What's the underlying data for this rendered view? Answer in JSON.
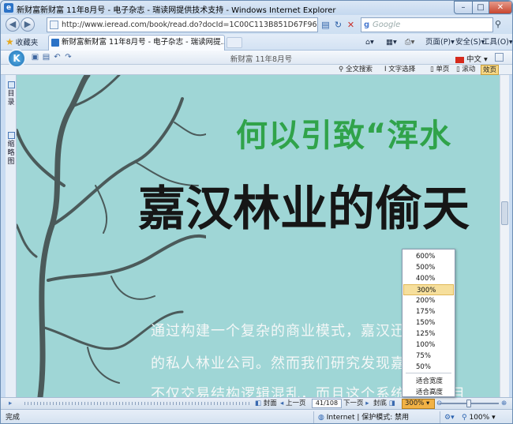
{
  "window": {
    "title": "新财富新财富 11年8月号 - 电子杂志 - 瑞读网提供技术支持 - Windows Internet Explorer",
    "min_label": "–",
    "max_label": "□",
    "close_label": "✕"
  },
  "address": {
    "url": "http://www.ieread.com/book/read.do?docId=1C00C113B851D67F965CF0F514AE4139",
    "search_placeholder": "Google"
  },
  "tabs": {
    "favorites_label": "收藏夹",
    "active_tab": "新财富新财富 11年8月号 - 电子杂志 - 瑞读网提..."
  },
  "commands": {
    "page": "页面(P)",
    "safety": "安全(S)",
    "tools": "工具(O)",
    "help": "❓"
  },
  "reader": {
    "magazine_title": "新财富 11年8月号",
    "language": "中文",
    "fulltext_search": "全文搜索",
    "text_select": "文字选择",
    "single_page": "单页",
    "scroll": "滚动",
    "effect": "效页"
  },
  "side_panel": {
    "toc": "目录",
    "thumbnails": "缩略图"
  },
  "page_content": {
    "headline_green": "何以引致“浑水",
    "headline_black": "嘉汉林业的偷天",
    "body_lines": [
      "通过构建一个复杂的商业模式，嘉汉迅速成",
      "的私人林业公司。然而我们研究发现嘉汉的商",
      "不仅交易结构逻辑混乱，而且这个系统安排的目"
    ]
  },
  "zoom_menu": {
    "options": [
      "600%",
      "500%",
      "400%",
      "300%",
      "200%",
      "175%",
      "150%",
      "125%",
      "100%",
      "75%",
      "50%"
    ],
    "selected": "300%",
    "fit_width": "适合宽度",
    "fit_height": "适合高度"
  },
  "bottom_bar": {
    "cover": "封面",
    "prev": "上一页",
    "page_indicator": "41/108",
    "next": "下一页",
    "back_cover": "封底",
    "zoom_value": "300%"
  },
  "status": {
    "text": "完成",
    "zone": "Internet | 保护模式: 禁用",
    "zoom": "100%"
  }
}
